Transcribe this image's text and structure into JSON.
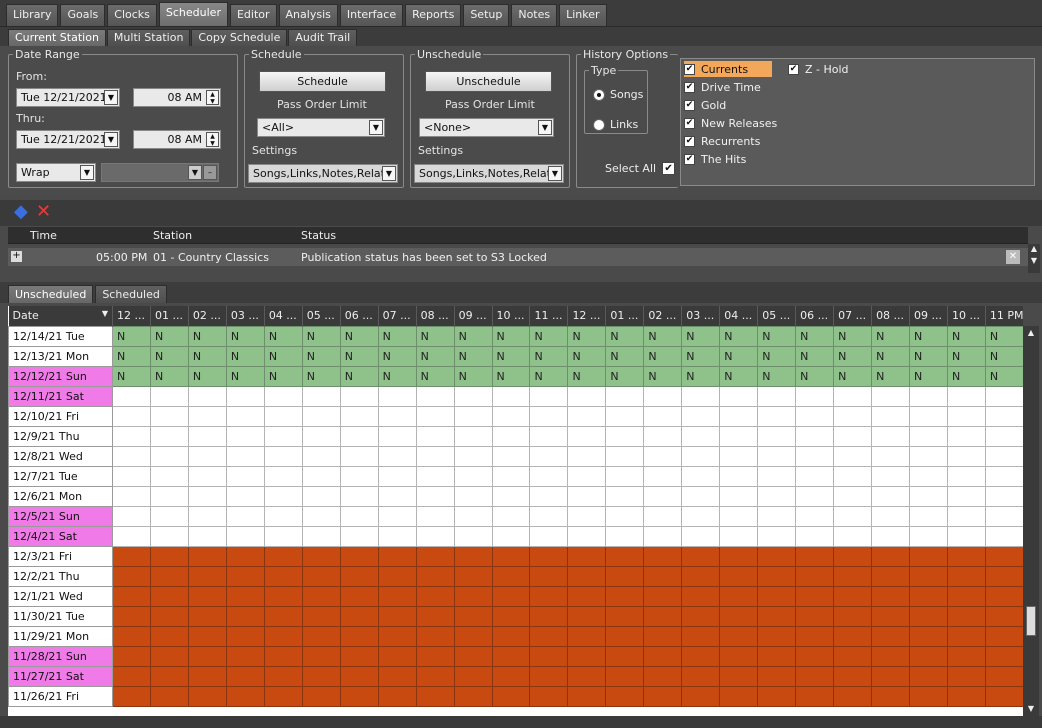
{
  "top_tabs": [
    {
      "label": "Library"
    },
    {
      "label": "Goals"
    },
    {
      "label": "Clocks"
    },
    {
      "label": "Scheduler"
    },
    {
      "label": "Editor"
    },
    {
      "label": "Analysis"
    },
    {
      "label": "Interface"
    },
    {
      "label": "Reports"
    },
    {
      "label": "Setup"
    },
    {
      "label": "Notes"
    },
    {
      "label": "Linker"
    }
  ],
  "sub_tabs": [
    {
      "label": "Current Station"
    },
    {
      "label": "Multi Station"
    },
    {
      "label": "Copy Schedule"
    },
    {
      "label": "Audit Trail"
    }
  ],
  "date_range": {
    "legend": "Date Range",
    "from_label": "From:",
    "from_date": "Tue 12/21/2021",
    "from_time": "08 AM",
    "thru_label": "Thru:",
    "thru_date": "Tue 12/21/2021",
    "thru_time": "08 AM",
    "wrap": "Wrap"
  },
  "schedule": {
    "legend": "Schedule",
    "button": "Schedule",
    "pass_order_label": "Pass Order Limit",
    "pass_order_value": "<All>",
    "settings_label": "Settings",
    "settings_value": "Songs,Links,Notes,Relat..."
  },
  "unschedule": {
    "legend": "Unschedule",
    "button": "Unschedule",
    "pass_order_label": "Pass Order Limit",
    "pass_order_value": "<None>",
    "settings_label": "Settings",
    "settings_value": "Songs,Links,Notes,Relat..."
  },
  "history": {
    "legend": "History Options",
    "type_legend": "Type",
    "radio_songs": "Songs",
    "radio_links": "Links",
    "select_all": "Select All",
    "items": [
      "Currents",
      "Drive Time",
      "Gold",
      "New Releases",
      "Recurrents",
      "The Hits"
    ],
    "item_z": "Z - Hold",
    "checked_mark": "✔"
  },
  "log": {
    "col_time": "Time",
    "col_station": "Station",
    "col_status": "Status",
    "row_time": "05:00 PM",
    "row_station": "01 - Country Classics",
    "row_status": "Publication status has been set to S3 Locked"
  },
  "grid_tabs": [
    {
      "label": "Unscheduled"
    },
    {
      "label": "Scheduled"
    }
  ],
  "schedule_grid": {
    "date_header": "Date",
    "hour_headers": [
      "12 ...",
      "01 ...",
      "02 ...",
      "03 ...",
      "04 ...",
      "05 ...",
      "06 ...",
      "07 ...",
      "08 ...",
      "09 ...",
      "10 ...",
      "11 ...",
      "12 ...",
      "01 ...",
      "02 ...",
      "03 ...",
      "04 ...",
      "05 ...",
      "06 ...",
      "07 ...",
      "08 ...",
      "09 ...",
      "10 ...",
      "11 PM"
    ],
    "rows": [
      {
        "date": "12/14/21 Tue",
        "weekend": false,
        "state": "N"
      },
      {
        "date": "12/13/21 Mon",
        "weekend": false,
        "state": "N"
      },
      {
        "date": "12/12/21 Sun",
        "weekend": true,
        "state": "N"
      },
      {
        "date": "12/11/21 Sat",
        "weekend": true,
        "state": "empty"
      },
      {
        "date": "12/10/21 Fri",
        "weekend": false,
        "state": "empty"
      },
      {
        "date": "12/9/21 Thu",
        "weekend": false,
        "state": "empty"
      },
      {
        "date": "12/8/21 Wed",
        "weekend": false,
        "state": "empty"
      },
      {
        "date": "12/7/21 Tue",
        "weekend": false,
        "state": "empty"
      },
      {
        "date": "12/6/21 Mon",
        "weekend": false,
        "state": "empty"
      },
      {
        "date": "12/5/21 Sun",
        "weekend": true,
        "state": "empty"
      },
      {
        "date": "12/4/21 Sat",
        "weekend": true,
        "state": "empty"
      },
      {
        "date": "12/3/21 Fri",
        "weekend": false,
        "state": "locked"
      },
      {
        "date": "12/2/21 Thu",
        "weekend": false,
        "state": "locked"
      },
      {
        "date": "12/1/21 Wed",
        "weekend": false,
        "state": "locked"
      },
      {
        "date": "11/30/21 Tue",
        "weekend": false,
        "state": "locked"
      },
      {
        "date": "11/29/21 Mon",
        "weekend": false,
        "state": "locked"
      },
      {
        "date": "11/28/21 Sun",
        "weekend": true,
        "state": "locked"
      },
      {
        "date": "11/27/21 Sat",
        "weekend": true,
        "state": "locked"
      },
      {
        "date": "11/26/21 Fri",
        "weekend": false,
        "state": "locked"
      }
    ],
    "n_label": "N"
  },
  "colors": {
    "n_cell": "#8fc18a",
    "locked_cell": "#c84a10",
    "weekend_date": "#f07be8",
    "highlight": "#f3a75a"
  },
  "icons": {
    "eraser": "eraser-icon",
    "delete": "close-icon",
    "plus": "+"
  }
}
